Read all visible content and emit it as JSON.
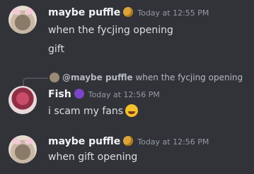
{
  "messages": [
    {
      "author": "maybe puffle",
      "timestamp": "Today at 12:55 PM",
      "lines": [
        "when the fycjing opening",
        "gift"
      ]
    },
    {
      "author": "Fish",
      "timestamp": "Today at 12:56 PM",
      "reply": {
        "author": "@maybe puffle",
        "text": "when the fycjing opening"
      },
      "lines": [
        "i scam my fans"
      ]
    },
    {
      "author": "maybe puffle",
      "timestamp": "Today at 12:56 PM",
      "lines": [
        "when gift opening"
      ]
    }
  ],
  "colors": {
    "background": "#313338",
    "author": "#f2f3f5",
    "text": "#dbdee1",
    "timestamp": "#949ba4"
  },
  "icons": [
    "cat-avatar-icon",
    "fish-avatar-icon",
    "smirk-badge-icon",
    "devil-badge-icon",
    "laughing-emoji-icon"
  ]
}
